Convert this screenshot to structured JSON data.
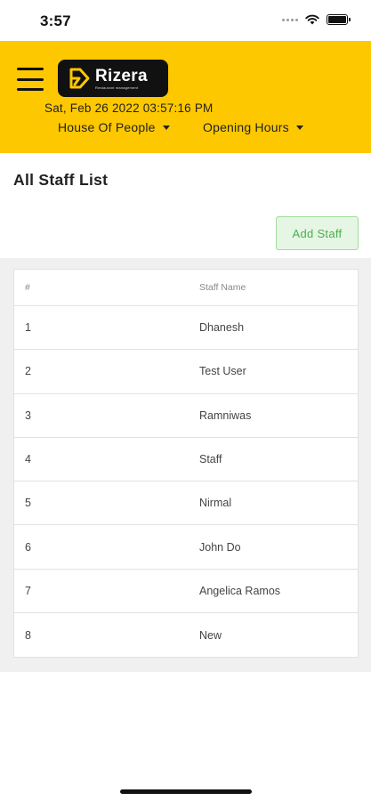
{
  "status_bar": {
    "time": "3:57"
  },
  "header": {
    "logo_text": "Rizera",
    "logo_tagline": "Restaurant management",
    "datetime": "Sat, Feb 26 2022  03:57:16 PM",
    "restaurant_dropdown": "House Of People",
    "hours_dropdown": "Opening Hours",
    "brand_color": "#fdc800"
  },
  "page": {
    "title": "All Staff List",
    "add_button": "Add Staff"
  },
  "table": {
    "headers": [
      "#",
      "Staff Name"
    ],
    "rows": [
      {
        "num": "1",
        "name": "Dhanesh"
      },
      {
        "num": "2",
        "name": "Test User"
      },
      {
        "num": "3",
        "name": "Ramniwas"
      },
      {
        "num": "4",
        "name": "Staff"
      },
      {
        "num": "5",
        "name": "Nirmal"
      },
      {
        "num": "6",
        "name": "John Do"
      },
      {
        "num": "7",
        "name": "Angelica Ramos"
      },
      {
        "num": "8",
        "name": "New"
      }
    ]
  }
}
